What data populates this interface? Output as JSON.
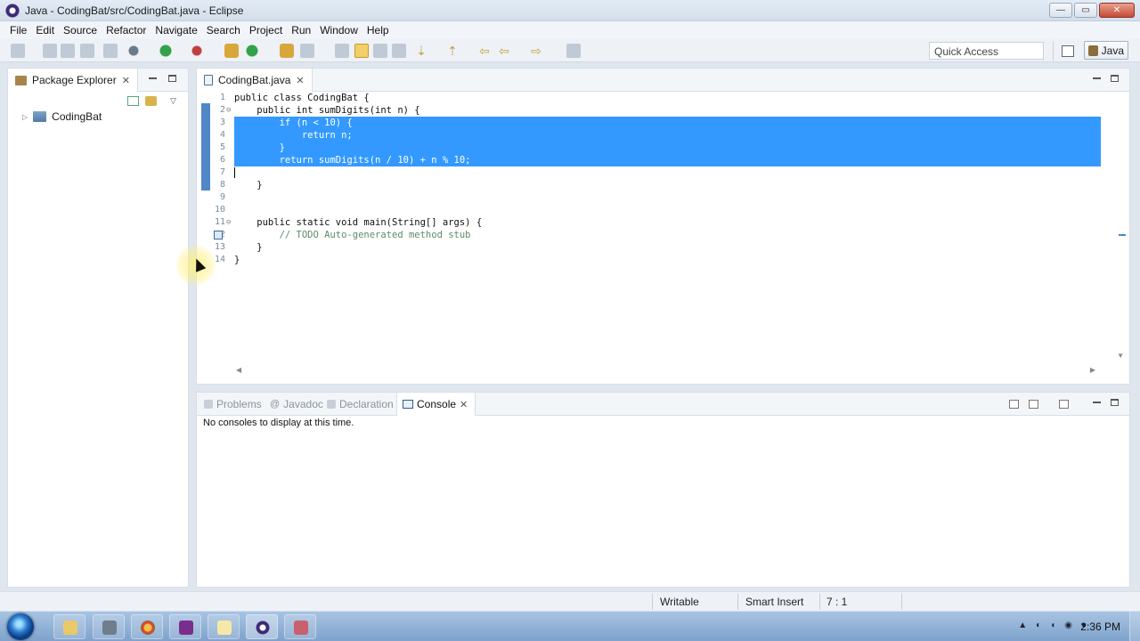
{
  "window": {
    "title": "Java - CodingBat/src/CodingBat.java - Eclipse",
    "minimize_label": "—",
    "maximize_label": "▭",
    "close_label": "✕"
  },
  "menu": [
    "File",
    "Edit",
    "Source",
    "Refactor",
    "Navigate",
    "Search",
    "Project",
    "Run",
    "Window",
    "Help"
  ],
  "toolbar": {
    "quick_access_placeholder": "Quick Access",
    "perspective_label": "Java"
  },
  "package_explorer": {
    "title": "Package Explorer",
    "project": "CodingBat"
  },
  "editor": {
    "tab_label": "CodingBat.java",
    "lines": [
      {
        "num": "1",
        "text": "public class CodingBat {",
        "fold": ""
      },
      {
        "num": "2",
        "text": "    public int sumDigits(int n) {",
        "fold": "⊖"
      },
      {
        "num": "3",
        "text": "        if (n < 10) {",
        "fold": ""
      },
      {
        "num": "4",
        "text": "            return n;",
        "fold": ""
      },
      {
        "num": "5",
        "text": "        }",
        "fold": ""
      },
      {
        "num": "6",
        "text": "        return sumDigits(n / 10) + n % 10;",
        "fold": ""
      },
      {
        "num": "7",
        "text": "",
        "fold": ""
      },
      {
        "num": "8",
        "text": "    }",
        "fold": ""
      },
      {
        "num": "9",
        "text": "",
        "fold": ""
      },
      {
        "num": "10",
        "text": "",
        "fold": ""
      },
      {
        "num": "11",
        "text": "    public static void main(String[] args) {",
        "fold": "⊖"
      },
      {
        "num": "12",
        "text": "        // TODO Auto-generated method stub",
        "fold": ""
      },
      {
        "num": "13",
        "text": "    }",
        "fold": ""
      },
      {
        "num": "14",
        "text": "}",
        "fold": ""
      }
    ]
  },
  "console": {
    "tabs": [
      "Problems",
      "Javadoc",
      "Declaration",
      "Console"
    ],
    "active_tab": "Console",
    "message": "No consoles to display at this time."
  },
  "status": {
    "writable": "Writable",
    "insert_mode": "Smart Insert",
    "position": "7 : 1"
  },
  "taskbar": {
    "clock": "2:36 PM"
  }
}
